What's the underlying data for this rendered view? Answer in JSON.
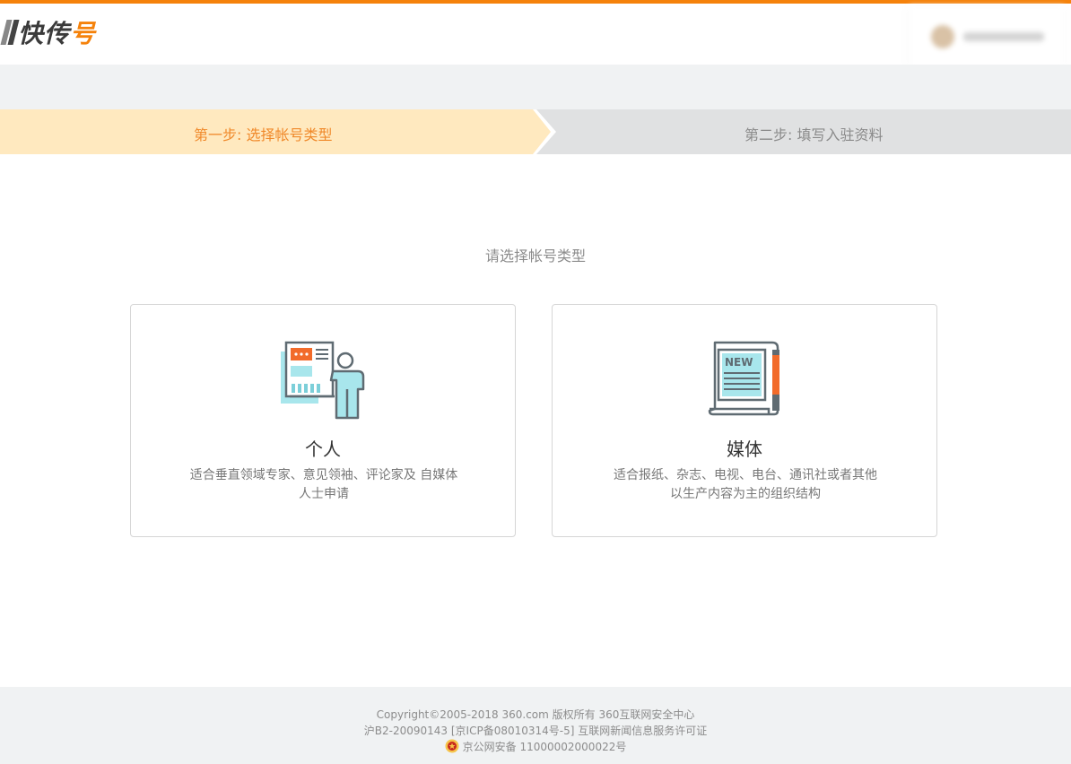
{
  "brand": {
    "logo_text": "快传",
    "logo_text_accent": "号"
  },
  "steps": {
    "step1_label": "第一步: 选择帐号类型",
    "step2_label": "第二步: 填写入驻资料"
  },
  "main": {
    "prompt": "请选择帐号类型",
    "cards": [
      {
        "title": "个人",
        "desc": "适合垂直领域专家、意见领袖、评论家及 自媒体人士申请",
        "icon": "presenter-icon"
      },
      {
        "title": "媒体",
        "desc": "适合报纸、杂志、电视、电台、通讯社或者其他以生产内容为主的组织结构",
        "icon": "newspaper-icon"
      }
    ]
  },
  "footer": {
    "copyright": "Copyright©2005-2018 360.com 版权所有 360互联网安全中心",
    "license": "沪B2-20090143 [京ICP备08010314号-5] 互联网新闻信息服务许可证",
    "security": "京公网安备 11000002000022号"
  },
  "colors": {
    "accent": "#f5820b",
    "active_step_bg": "#ffe9bf",
    "active_step_text": "#f0892a",
    "inactive_step_bg": "#e0e1e2"
  },
  "icons": [
    "presenter-icon",
    "newspaper-icon",
    "police-badge-icon"
  ]
}
